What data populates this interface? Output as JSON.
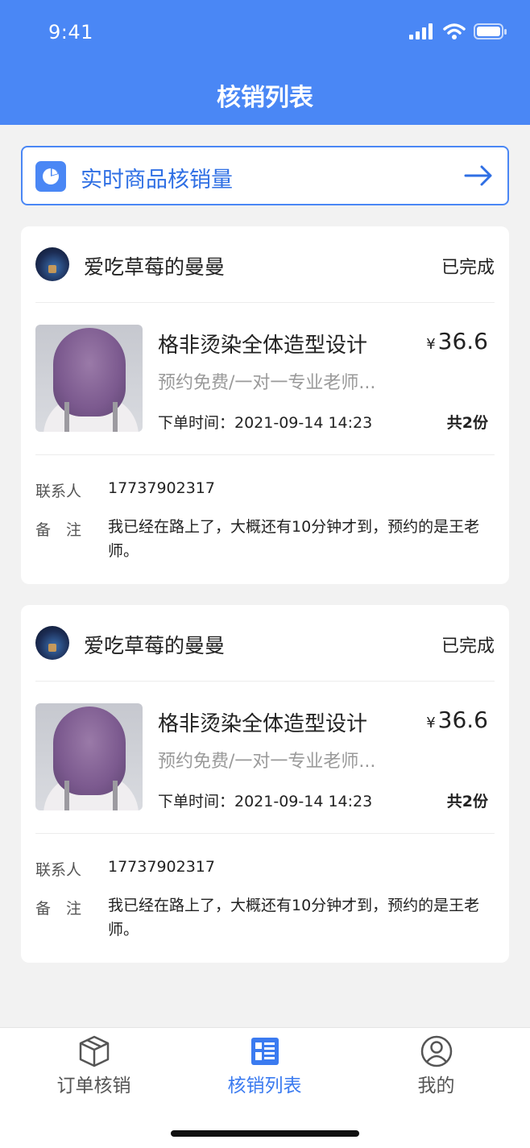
{
  "status_bar": {
    "time": "9:41"
  },
  "header": {
    "title": "核销列表"
  },
  "banner": {
    "label": "实时商品核销量"
  },
  "orders": [
    {
      "user_name": "爱吃草莓的曼曼",
      "status": "已完成",
      "product_name": "格非烫染全体造型设计",
      "price_symbol": "¥",
      "price": "36.6",
      "description": "预约免费/一对一专业老师...",
      "order_time": "下单时间：2021-09-14 14:23",
      "quantity": "共2份",
      "contact_label": "联系人",
      "contact_value": "17737902317",
      "remark_label": "备　注",
      "remark_value": "我已经在路上了，大概还有10分钟才到，预约的是王老师。"
    },
    {
      "user_name": "爱吃草莓的曼曼",
      "status": "已完成",
      "product_name": "格非烫染全体造型设计",
      "price_symbol": "¥",
      "price": "36.6",
      "description": "预约免费/一对一专业老师...",
      "order_time": "下单时间：2021-09-14 14:23",
      "quantity": "共2份",
      "contact_label": "联系人",
      "contact_value": "17737902317",
      "remark_label": "备　注",
      "remark_value": "我已经在路上了，大概还有10分钟才到，预约的是王老师。"
    }
  ],
  "tabbar": {
    "items": [
      {
        "label": "订单核销",
        "icon": "box-icon",
        "active": false
      },
      {
        "label": "核销列表",
        "icon": "list-icon",
        "active": true
      },
      {
        "label": "我的",
        "icon": "user-icon",
        "active": false
      }
    ]
  },
  "colors": {
    "primary": "#4a87f5",
    "active_tab": "#3b7bf0",
    "background": "#f2f2f2"
  }
}
